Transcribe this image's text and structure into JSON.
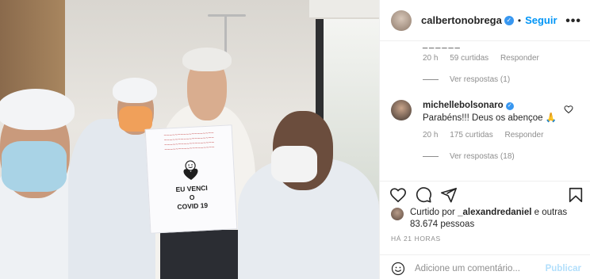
{
  "post": {
    "author": "calbertonobrega",
    "follow_label": "Seguir",
    "more_label": "•••"
  },
  "sign": {
    "line1": "EU VENCI",
    "line2": "O",
    "line3": "COVID 19"
  },
  "comments": {
    "previous": {
      "partial_text": "______",
      "time": "20 h",
      "likes": "59 curtidas",
      "reply_label": "Responder",
      "view_replies": "Ver respostas (1)"
    },
    "second": {
      "user": "michellebolsonaro",
      "text": "Parabéns!!! Deus os abençoe 🙏",
      "time": "20 h",
      "likes": "175 curtidas",
      "reply_label": "Responder",
      "view_replies": "Ver respostas (18)"
    }
  },
  "likes_info": {
    "prefix": "Curtido por",
    "user": "_alexandredaniel",
    "suffix": "e outras 83.674 pessoas"
  },
  "timestamp": "HÁ 21 HORAS",
  "add_comment": {
    "placeholder": "Adicione um comentário...",
    "publish_label": "Publicar"
  },
  "colors": {
    "link_blue": "#0095f6",
    "publish_disabled": "#b2dffc",
    "muted": "#8e8e8e"
  }
}
